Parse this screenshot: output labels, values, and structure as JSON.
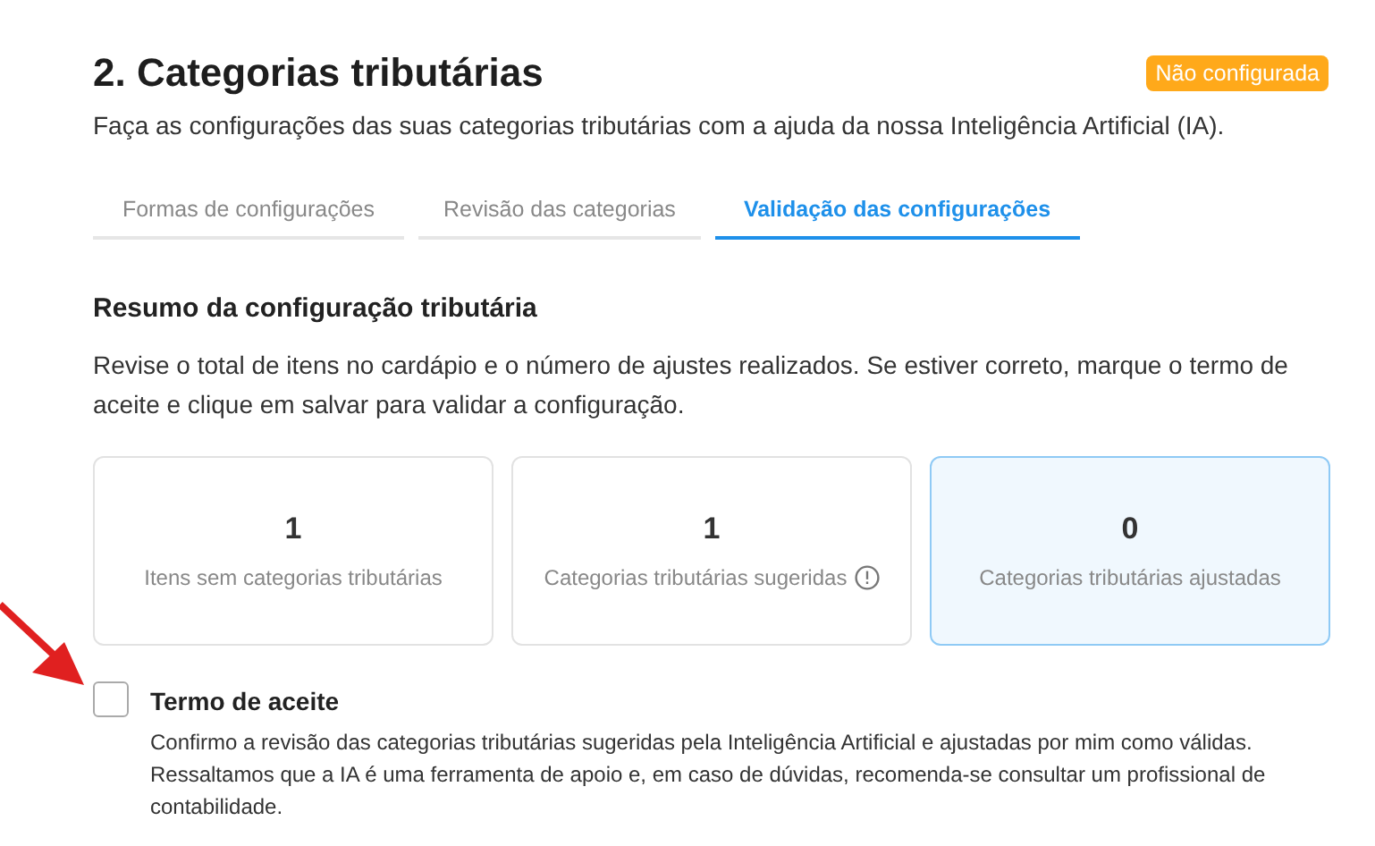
{
  "header": {
    "title": "2. Categorias tributárias",
    "status_badge": "Não configurada",
    "subtitle": "Faça as configurações das suas categorias tributárias com a ajuda da nossa Inteligência Artificial (IA)."
  },
  "tabs": [
    {
      "label": "Formas de configurações",
      "selected": false
    },
    {
      "label": "Revisão das categorias",
      "selected": false
    },
    {
      "label": "Validação das configurações",
      "selected": true
    }
  ],
  "summary": {
    "heading": "Resumo da configuração tributária",
    "description": "Revise o total de itens no cardápio e o número de ajustes realizados. Se estiver correto, marque o termo de aceite e clique em salvar para validar a configuração.",
    "cards": [
      {
        "value": "1",
        "label": "Itens sem categorias tributárias",
        "info": false,
        "selected": false
      },
      {
        "value": "1",
        "label": "Categorias tributárias sugeridas",
        "info": true,
        "selected": false
      },
      {
        "value": "0",
        "label": "Categorias tributárias ajustadas",
        "info": false,
        "selected": true
      }
    ]
  },
  "acceptance": {
    "checked": false,
    "title": "Termo de aceite",
    "text": "Confirmo a revisão das categorias tributárias sugeridas pela Inteligência Artificial e ajustadas por mim como válidas. Ressaltamos que a IA é uma ferramenta de apoio e, em caso de dúvidas, recomenda-se consultar um profissional de contabilidade."
  }
}
